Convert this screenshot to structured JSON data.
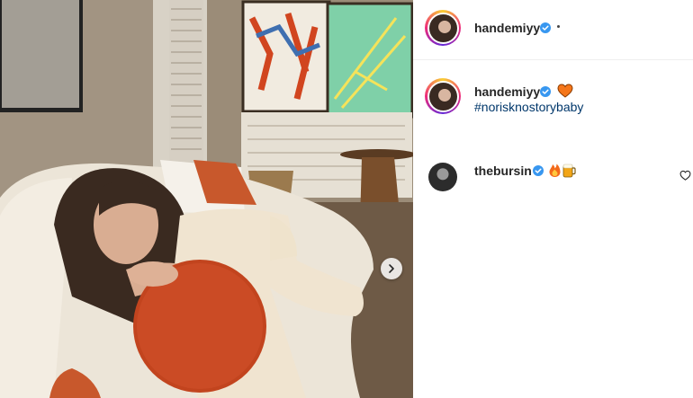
{
  "post": {
    "author": {
      "username": "handemiyy",
      "verified": true
    },
    "caption": {
      "username": "handemiyy",
      "emoji": "orange-heart",
      "hashtag": "#norisknostorybaby"
    },
    "comments": [
      {
        "username": "thebursin",
        "verified": true,
        "emojis": [
          "fire",
          "beer-mug"
        ]
      }
    ]
  },
  "icons": {
    "verified": "verified-badge-icon",
    "next": "chevron-right-icon",
    "like": "heart-outline-icon"
  },
  "colors": {
    "verified_blue": "#3897f0",
    "hashtag_blue": "#00376b",
    "text": "#262626",
    "orange_heart": "#f5761a"
  }
}
